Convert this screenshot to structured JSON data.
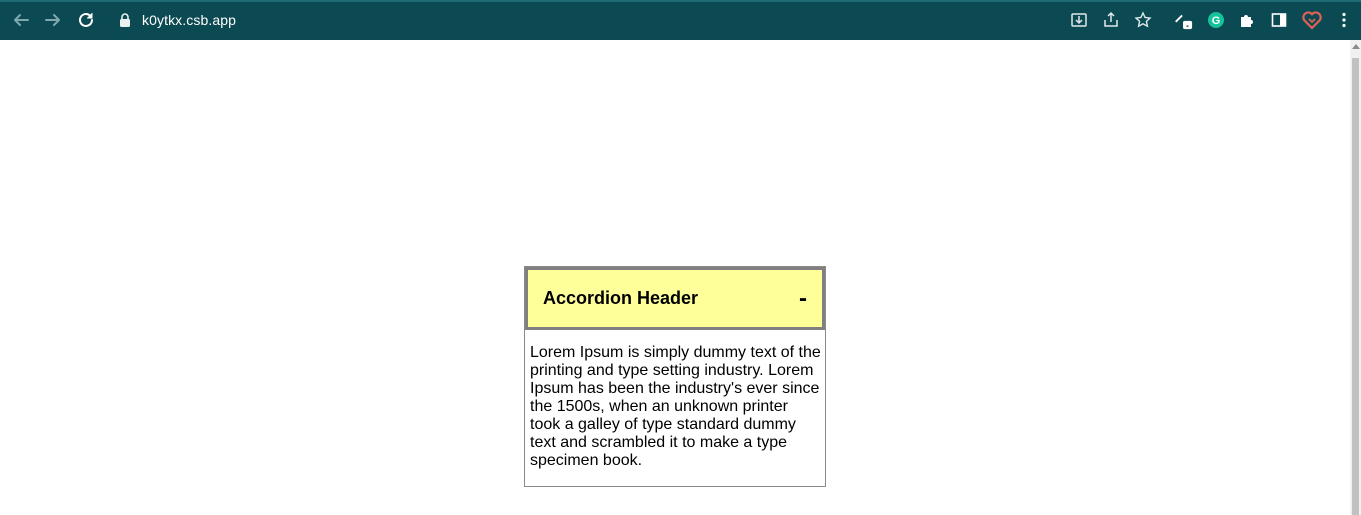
{
  "browser": {
    "url": "k0ytkx.csb.app",
    "icons": {
      "back": "arrow-left-icon",
      "forward": "arrow-right-icon",
      "reload": "reload-icon",
      "lock": "lock-icon",
      "install": "install-app-icon",
      "share": "share-icon",
      "bookmark": "star-icon",
      "ext_pen": "pen-extension-icon",
      "ext_grammarly": "grammarly-icon",
      "extensions": "puzzle-icon",
      "side_panel": "side-panel-icon",
      "ext_heart": "heart-extension-icon",
      "menu": "kebab-menu-icon"
    },
    "colors": {
      "toolbar": "#0b4a52",
      "text": "#ffffff"
    }
  },
  "accordion": {
    "header": "Accordion Header",
    "toggle": "-",
    "body": "Lorem Ipsum is simply dummy text of the printing and type setting industry. Lorem Ipsum has been the industry's ever since the 1500s, when an unknown printer took a galley of type standard dummy text and scrambled it to make a type specimen book.",
    "colors": {
      "header_bg": "#ffff99",
      "header_border": "#808080",
      "body_border": "#8a8a8a"
    }
  }
}
